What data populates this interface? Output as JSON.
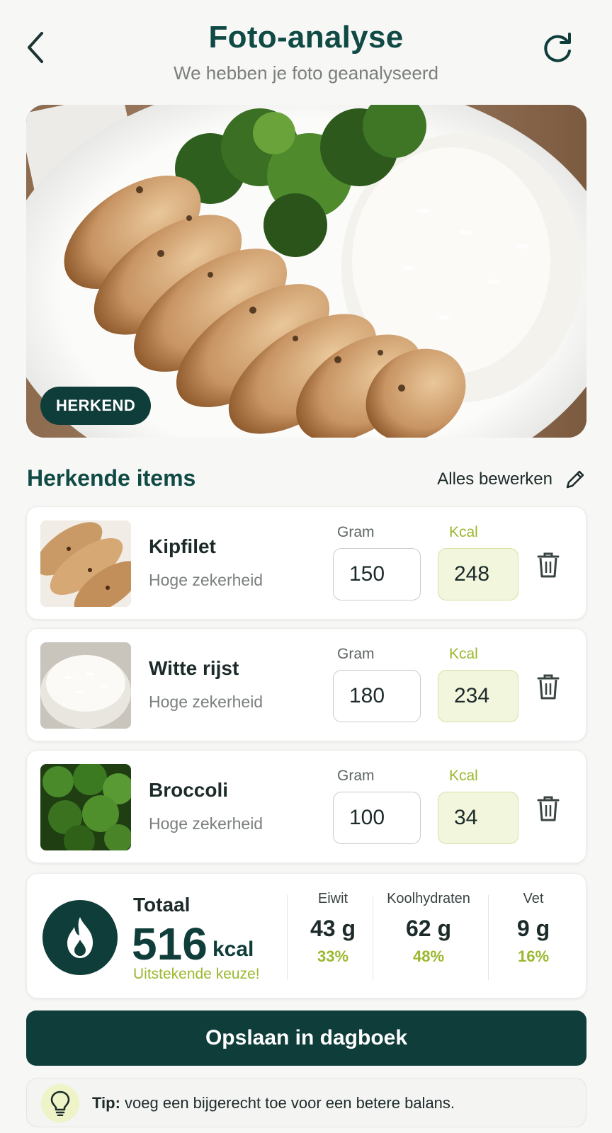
{
  "header": {
    "title": "Foto-analyse",
    "subtitle": "We hebben je foto geanalyseerd",
    "back_icon": "chevron-left-icon",
    "refresh_icon": "refresh-icon"
  },
  "photo": {
    "badge": "HERKEND"
  },
  "items_section": {
    "title": "Herkende items",
    "edit_all_label": "Alles bewerken",
    "edit_icon": "pencil-icon"
  },
  "items": [
    {
      "name": "Kipfilet",
      "confidence": "Hoge zekerheid",
      "gram_label": "Gram",
      "kcal_label": "Kcal",
      "gram": "150",
      "kcal": "248"
    },
    {
      "name": "Witte rijst",
      "confidence": "Hoge zekerheid",
      "gram_label": "Gram",
      "kcal_label": "Kcal",
      "gram": "180",
      "kcal": "234"
    },
    {
      "name": "Broccoli",
      "confidence": "Hoge zekerheid",
      "gram_label": "Gram",
      "kcal_label": "Kcal",
      "gram": "100",
      "kcal": "34"
    }
  ],
  "total": {
    "label": "Totaal",
    "value": "516",
    "unit": "kcal",
    "note": "Uitstekende keuze!",
    "macros": [
      {
        "name": "Eiwit",
        "value": "43 g",
        "pct": "33%"
      },
      {
        "name": "Koolhydraten",
        "value": "62 g",
        "pct": "48%"
      },
      {
        "name": "Vet",
        "value": "9 g",
        "pct": "16%"
      }
    ]
  },
  "save_button": "Opslaan in dagboek",
  "tip": {
    "prefix": "Tip:",
    "text": " voeg een bijgerecht toe voor een betere balans."
  },
  "colors": {
    "primary": "#0f3d3a",
    "accent": "#9ab82e",
    "kcal_bg": "#f2f6dc"
  }
}
